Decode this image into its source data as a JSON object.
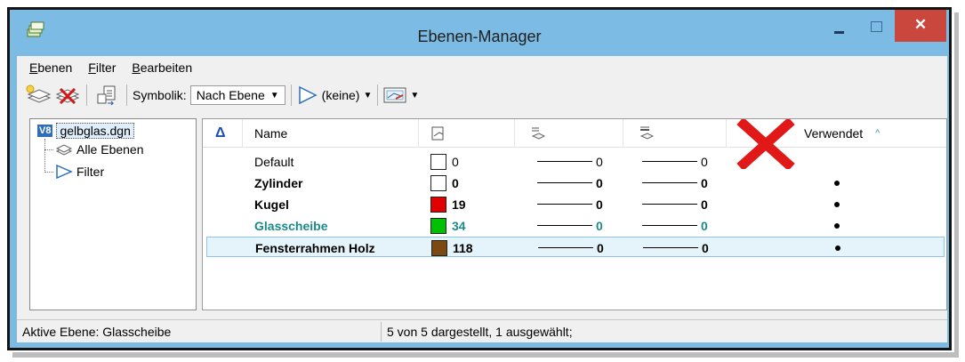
{
  "window": {
    "title": "Ebenen-Manager",
    "close_glyph": "✕",
    "accent": "#7bbbe3",
    "close_color": "#c9473d"
  },
  "menu": [
    "Ebenen",
    "Filter",
    "Bearbeiten"
  ],
  "toolbar": {
    "symbolik_label": "Symbolik:",
    "symbolik_value": "Nach Ebene",
    "filter_value": "(keine)"
  },
  "tree": {
    "root_badge": "V8",
    "root_label": "gelbglas.dgn",
    "children": [
      "Alle Ebenen",
      "Filter"
    ]
  },
  "list": {
    "sort_indicator": "Δ",
    "columns": {
      "name": "Name",
      "used": "Verwendet"
    },
    "rows": [
      {
        "name": "Default",
        "color_num": "0",
        "style": "0",
        "weight": "0",
        "used": false,
        "bold": false,
        "color": "#000000",
        "swatch": "#ffffff"
      },
      {
        "name": "Zylinder",
        "color_num": "0",
        "style": "0",
        "weight": "0",
        "used": true,
        "bold": true,
        "color": "#000000",
        "swatch": "#ffffff"
      },
      {
        "name": "Kugel",
        "color_num": "19",
        "style": "0",
        "weight": "0",
        "used": true,
        "bold": true,
        "color": "#000000",
        "swatch": "#e00000"
      },
      {
        "name": "Glasscheibe",
        "color_num": "34",
        "style": "0",
        "weight": "0",
        "used": true,
        "bold": true,
        "color": "#1a8a8a",
        "swatch": "#00c000"
      },
      {
        "name": "Fensterrahmen Holz",
        "color_num": "118",
        "style": "0",
        "weight": "0",
        "used": true,
        "bold": true,
        "color": "#000000",
        "swatch": "#7a4a12",
        "selected": true
      }
    ]
  },
  "status": {
    "active_layer": "Aktive Ebene: Glasscheibe",
    "summary": "5 von 5 dargestellt, 1 ausgewählt;"
  },
  "annotation_cross_color": "#e11818"
}
